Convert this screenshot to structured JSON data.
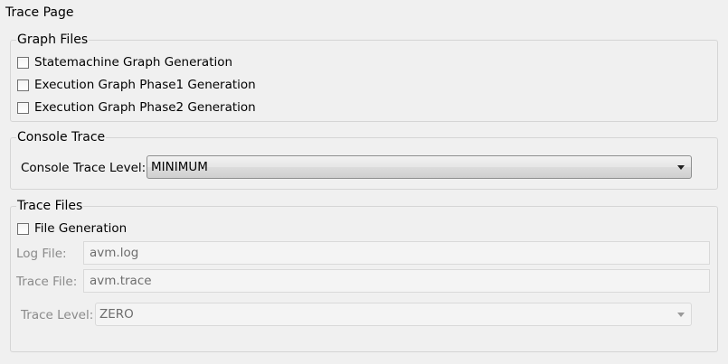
{
  "page": {
    "title": "Trace Page"
  },
  "graph_files": {
    "title": "Graph Files",
    "checkboxes": [
      {
        "label": "Statemachine Graph Generation",
        "checked": false
      },
      {
        "label": "Execution Graph Phase1 Generation",
        "checked": false
      },
      {
        "label": "Execution Graph Phase2 Generation",
        "checked": false
      }
    ]
  },
  "console_trace": {
    "title": "Console Trace",
    "level_label": "Console Trace Level:",
    "level_value": "MINIMUM"
  },
  "trace_files": {
    "title": "Trace Files",
    "file_generation": {
      "label": "File Generation",
      "checked": false
    },
    "log_file": {
      "label": "Log File:",
      "value": "avm.log"
    },
    "trace_file": {
      "label": "Trace File:",
      "value": "avm.trace"
    },
    "trace_level": {
      "label": "Trace Level:",
      "value": "ZERO"
    }
  }
}
